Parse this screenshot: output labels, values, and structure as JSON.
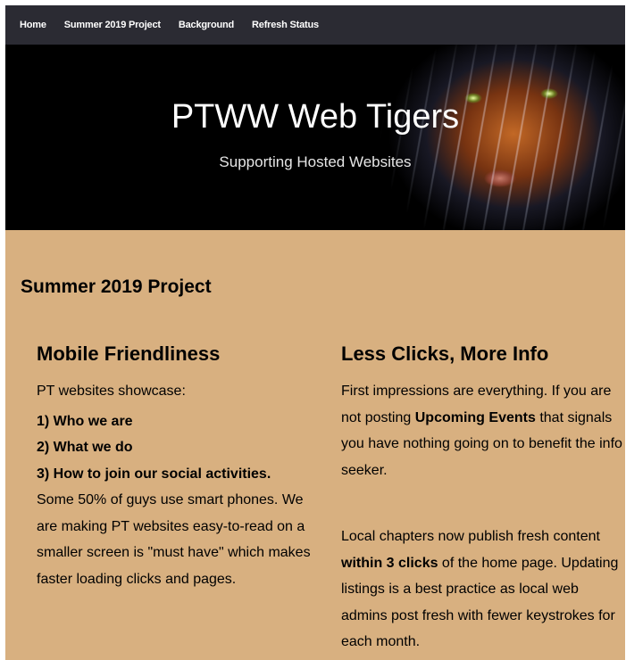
{
  "nav": {
    "items": [
      "Home",
      "Summer 2019 Project",
      "Background",
      "Refresh Status"
    ]
  },
  "hero": {
    "title": "PTWW Web Tigers",
    "subtitle": "Supporting Hosted Websites"
  },
  "page": {
    "section_title": "Summer 2019 Project"
  },
  "left": {
    "heading": "Mobile Friendliness",
    "intro": "PT websites showcase:",
    "list": [
      "1) Who we are",
      "2) What we do",
      "3) How to join our social activities."
    ],
    "paragraph": "Some 50% of guys use smart phones. We are making PT websites easy-to-read on a smaller screen is \"must have\" which makes faster loading clicks and pages."
  },
  "right": {
    "heading": "Less Clicks, More Info",
    "p1_a": "First impressions are everything.  If you are not posting ",
    "p1_bold": "Upcoming Events",
    "p1_b": " that signals you have nothing going on to benefit the info seeker.",
    "p2_a": "Local chapters now publish fresh content ",
    "p2_bold": "within 3 clicks",
    "p2_b": " of the home page.  Updating listings is a best practice as local web admins post fresh with fewer keystrokes for each month."
  }
}
